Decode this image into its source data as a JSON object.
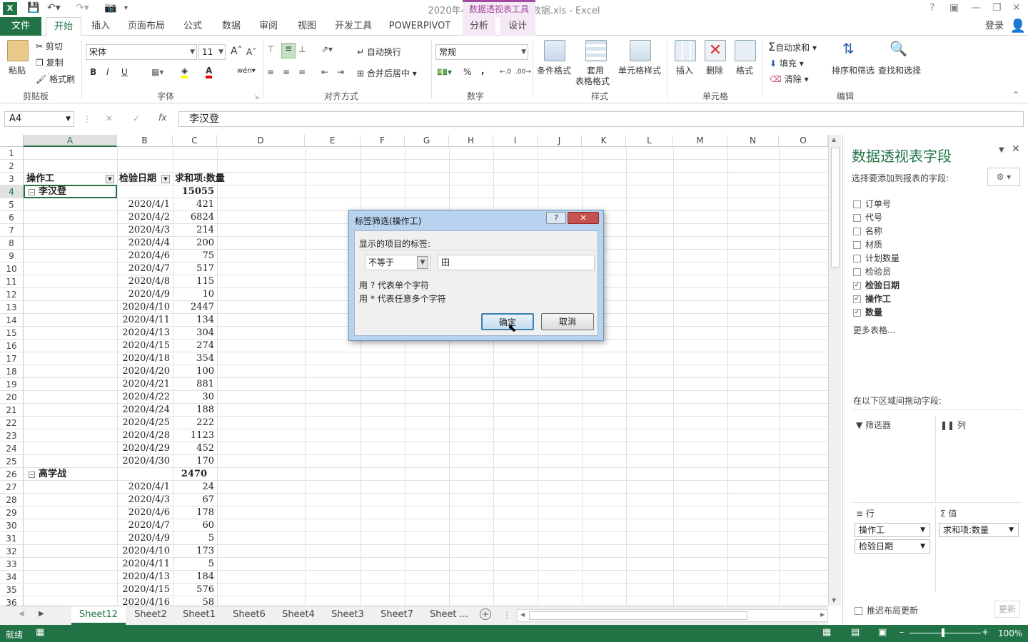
{
  "title_bar": {
    "app_icon": "X",
    "doc_title": "2020年4月金工车间检验数据.xls - Excel",
    "context_tool": "数据透视表工具",
    "help": "?",
    "login": "登录"
  },
  "tabs": [
    "文件",
    "开始",
    "插入",
    "页面布局",
    "公式",
    "数据",
    "审阅",
    "视图",
    "开发工具",
    "POWERPIVOT",
    "分析",
    "设计"
  ],
  "ribbon": {
    "clipboard": {
      "paste": "粘贴",
      "cut": "剪切",
      "copy": "复制",
      "format_painter": "格式刷",
      "label": "剪贴板"
    },
    "font": {
      "name": "宋体",
      "size": "11",
      "bold": "B",
      "italic": "I",
      "underline": "U",
      "label": "字体"
    },
    "alignment": {
      "wrap": "自动换行",
      "merge": "合并后居中",
      "label": "对齐方式"
    },
    "number": {
      "format": "常规",
      "percent": "%",
      "comma": ",",
      "label": "数字"
    },
    "styles": {
      "conditional": "条件格式",
      "table_line1": "套用",
      "table_line2": "表格格式",
      "cell_styles": "单元格样式",
      "label": "样式"
    },
    "cells": {
      "insert": "插入",
      "delete": "删除",
      "format": "格式",
      "label": "单元格"
    },
    "editing": {
      "autosum": "自动求和",
      "fill": "填充",
      "clear": "清除",
      "sort": "排序和筛选",
      "find": "查找和选择",
      "label": "编辑"
    }
  },
  "formula_bar": {
    "name_box": "A4",
    "value": "李汉登",
    "fx": "fx"
  },
  "columns": [
    "A",
    "B",
    "C",
    "D",
    "E",
    "F",
    "G",
    "H",
    "I",
    "J",
    "K",
    "L",
    "M",
    "N",
    "O"
  ],
  "rows": [
    "1",
    "2",
    "3",
    "4",
    "5",
    "6",
    "7",
    "8",
    "9",
    "10",
    "11",
    "12",
    "13",
    "14",
    "15",
    "16",
    "17",
    "18",
    "19",
    "20",
    "21",
    "22",
    "23",
    "24",
    "25",
    "26",
    "27",
    "28",
    "29",
    "30",
    "31",
    "32",
    "33",
    "34",
    "35",
    "36"
  ],
  "pivot": {
    "header_a": "操作工",
    "header_b": "检验日期",
    "header_c": "求和项:数量",
    "group1": {
      "name": "李汉登",
      "total": "15055"
    },
    "group1_rows": [
      [
        "2020/4/1",
        "421"
      ],
      [
        "2020/4/2",
        "6824"
      ],
      [
        "2020/4/3",
        "214"
      ],
      [
        "2020/4/4",
        "200"
      ],
      [
        "2020/4/6",
        "75"
      ],
      [
        "2020/4/7",
        "517"
      ],
      [
        "2020/4/8",
        "115"
      ],
      [
        "2020/4/9",
        "10"
      ],
      [
        "2020/4/10",
        "2447"
      ],
      [
        "2020/4/11",
        "134"
      ],
      [
        "2020/4/13",
        "304"
      ],
      [
        "2020/4/15",
        "274"
      ],
      [
        "2020/4/18",
        "354"
      ],
      [
        "2020/4/20",
        "100"
      ],
      [
        "2020/4/21",
        "881"
      ],
      [
        "2020/4/22",
        "30"
      ],
      [
        "2020/4/24",
        "188"
      ],
      [
        "2020/4/25",
        "222"
      ],
      [
        "2020/4/28",
        "1123"
      ],
      [
        "2020/4/29",
        "452"
      ],
      [
        "2020/4/30",
        "170"
      ]
    ],
    "group2": {
      "name": "高学战",
      "total": "2470"
    },
    "group2_rows": [
      [
        "2020/4/1",
        "24"
      ],
      [
        "2020/4/3",
        "67"
      ],
      [
        "2020/4/6",
        "178"
      ],
      [
        "2020/4/7",
        "60"
      ],
      [
        "2020/4/9",
        "5"
      ],
      [
        "2020/4/10",
        "173"
      ],
      [
        "2020/4/11",
        "5"
      ],
      [
        "2020/4/13",
        "184"
      ],
      [
        "2020/4/15",
        "576"
      ],
      [
        "2020/4/16",
        "58"
      ]
    ]
  },
  "dialog": {
    "title": "标签筛选(操作工)",
    "help": "?",
    "prompt": "显示的项目的标签:",
    "operator": "不等于",
    "value": "田",
    "hint1": "用 ? 代表单个字符",
    "hint2": "用 * 代表任意多个字符",
    "ok": "确定",
    "cancel": "取消"
  },
  "sheets": [
    "Sheet12",
    "Sheet2",
    "Sheet1",
    "Sheet6",
    "Sheet4",
    "Sheet3",
    "Sheet7",
    "Sheet ..."
  ],
  "status": {
    "mode": "就绪",
    "zoom": "100%"
  },
  "pane": {
    "title": "数据透视表字段",
    "subtitle": "选择要添加到报表的字段:",
    "fields": [
      {
        "label": "订单号",
        "checked": false
      },
      {
        "label": "代号",
        "checked": false
      },
      {
        "label": "名称",
        "checked": false
      },
      {
        "label": "材质",
        "checked": false
      },
      {
        "label": "计划数量",
        "checked": false
      },
      {
        "label": "检验员",
        "checked": false
      },
      {
        "label": "检验日期",
        "checked": true
      },
      {
        "label": "操作工",
        "checked": true
      },
      {
        "label": "数量",
        "checked": true
      }
    ],
    "more_tables": "更多表格...",
    "drag_label": "在以下区域间拖动字段:",
    "filters": "筛选器",
    "columns": "列",
    "rows": "行",
    "values": "值",
    "row_fields": [
      "操作工",
      "检验日期"
    ],
    "value_fields": [
      "求和项:数量"
    ],
    "defer": "推迟布局更新",
    "update": "更新"
  }
}
